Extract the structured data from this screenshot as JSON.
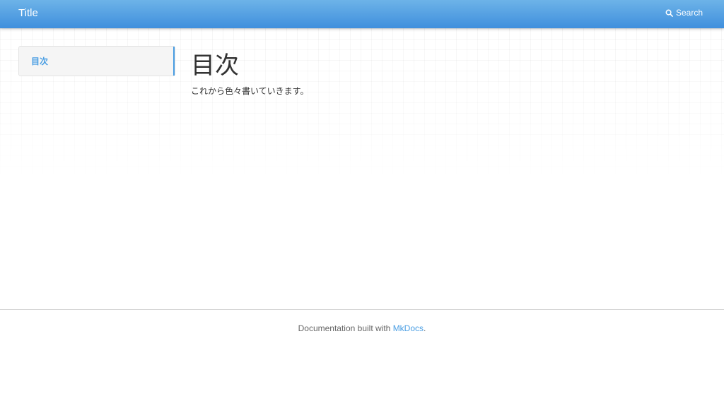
{
  "navbar": {
    "brand": "Title",
    "search_label": "Search",
    "search_icon": "search-icon",
    "accent_color": "#4a9ee3"
  },
  "sidebar": {
    "items": [
      {
        "label": "目次",
        "active": true
      }
    ]
  },
  "main": {
    "heading": "目次",
    "paragraph": "これから色々書いていきます。"
  },
  "footer": {
    "text_before": "Documentation built with ",
    "link_label": "MkDocs",
    "text_after": "."
  }
}
